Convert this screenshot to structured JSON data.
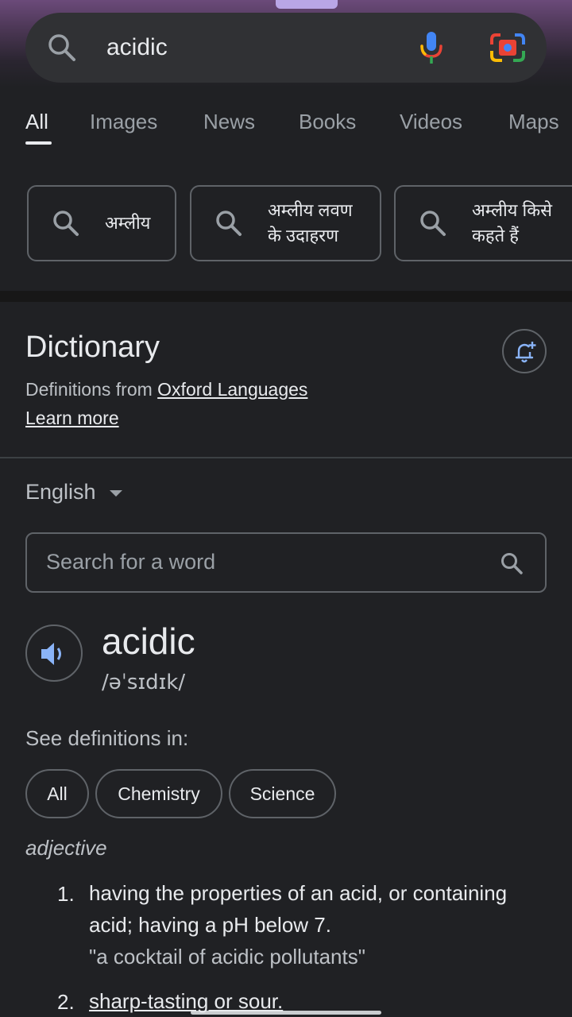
{
  "search": {
    "query": "acidic"
  },
  "tabs": [
    {
      "label": "All",
      "active": true
    },
    {
      "label": "Images"
    },
    {
      "label": "News"
    },
    {
      "label": "Books"
    },
    {
      "label": "Videos"
    },
    {
      "label": "Maps"
    }
  ],
  "related": [
    {
      "line1": "अम्लीय",
      "line2": ""
    },
    {
      "line1": "अम्लीय लवण",
      "line2": "के उदाहरण"
    },
    {
      "line1": "अम्लीय किसे",
      "line2": "कहते हैं"
    }
  ],
  "dictionary": {
    "title": "Dictionary",
    "from_prefix": "Definitions from ",
    "source": "Oxford Languages",
    "learn_more": "Learn more",
    "language": "English",
    "search_placeholder": "Search for a word",
    "word": "acidic",
    "phonetic": "/əˈsɪdɪk/",
    "see_definitions_label": "See definitions in:",
    "filters": [
      "All",
      "Chemistry",
      "Science"
    ],
    "part_of_speech": "adjective",
    "senses": [
      {
        "num": "1.",
        "text": "having the properties of an acid, or containing acid; having a pH below 7.",
        "example": "\"a cocktail of acidic pollutants\""
      },
      {
        "num": "2.",
        "text": "sharp-tasting or sour."
      }
    ]
  },
  "colors": {
    "background": "#202124",
    "surface": "#303134",
    "text": "#e8eaed",
    "muted": "#9aa0a6",
    "accent_blue": "#8ab4f8"
  }
}
